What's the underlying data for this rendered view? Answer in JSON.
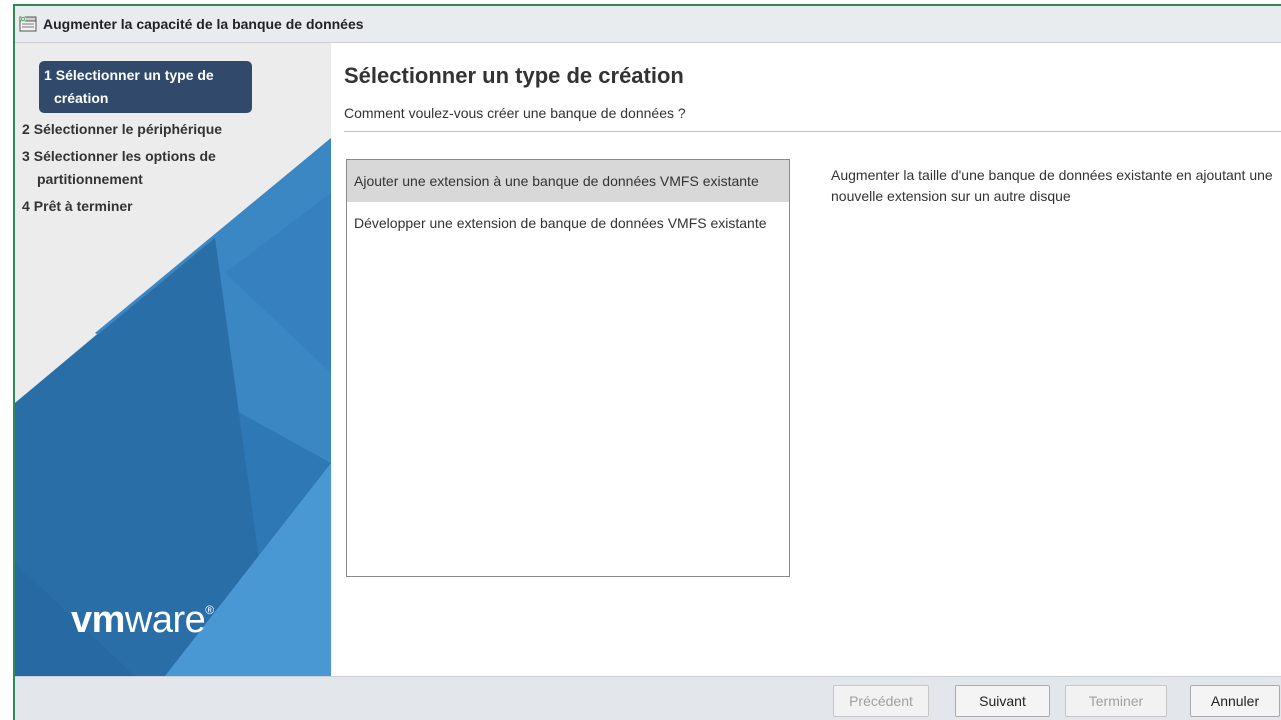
{
  "window": {
    "title": "Augmenter la capacité de la banque de données",
    "icon": "datastore-icon"
  },
  "sidebar": {
    "steps": [
      {
        "num": "1",
        "label": "Sélectionner un type de création",
        "active": true
      },
      {
        "num": "2",
        "label": "Sélectionner le périphérique",
        "active": false
      },
      {
        "num": "3",
        "label": "Sélectionner les options de partitionnement",
        "active": false
      },
      {
        "num": "4",
        "label": "Prêt à terminer",
        "active": false
      }
    ],
    "logo": {
      "vm": "vm",
      "ware": "ware",
      "reg": "®"
    }
  },
  "main": {
    "title": "Sélectionner un type de création",
    "subtitle": "Comment voulez-vous créer une banque de données ?",
    "options": [
      {
        "label": "Ajouter une extension à une banque de données VMFS existante",
        "selected": true
      },
      {
        "label": "Développer une extension de banque de données VMFS existante",
        "selected": false
      }
    ],
    "description": "Augmenter la taille d'une banque de données existante en ajoutant une nouvelle extension sur un autre disque"
  },
  "footer": {
    "previous": "Précédent",
    "next": "Suivant",
    "finish": "Terminer",
    "cancel": "Annuler"
  },
  "colors": {
    "frame_border": "#2e8b57",
    "active_step": "#314a6b",
    "sidebar_blue": "#2f78b6",
    "selected_option": "#d8d8d8"
  }
}
